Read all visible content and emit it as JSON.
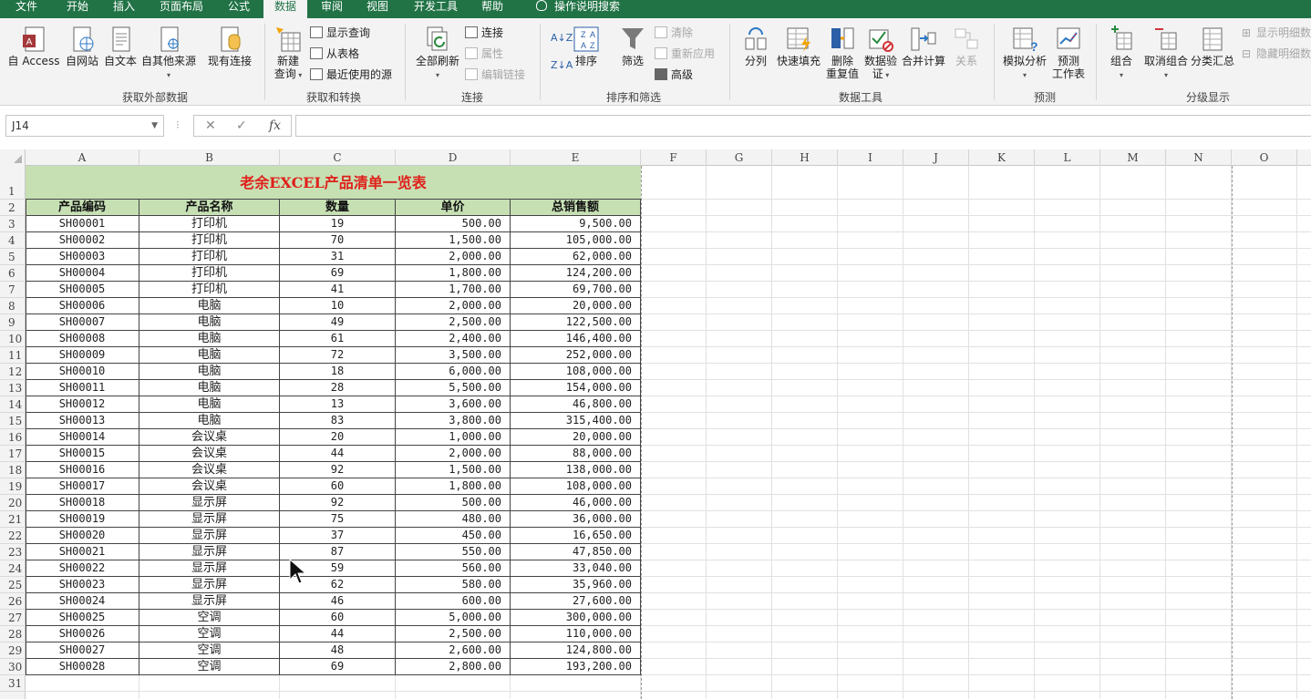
{
  "menu": {
    "tabs": [
      "文件",
      "开始",
      "插入",
      "页面布局",
      "公式",
      "数据",
      "审阅",
      "视图",
      "开发工具",
      "帮助"
    ],
    "active": "数据",
    "tell_me": "操作说明搜索"
  },
  "ribbon": {
    "get_external": {
      "group_label": "获取外部数据",
      "access": "自 Access",
      "web": "自网站",
      "text": "自文本",
      "other": "自其他来源",
      "existing": "现有连接"
    },
    "get_transform": {
      "group_label": "获取和转换",
      "new_query_1": "新建",
      "new_query_2": "查询",
      "show_queries": "显示查询",
      "from_table": "从表格",
      "recent_sources": "最近使用的源"
    },
    "connections": {
      "group_label": "连接",
      "refresh_all": "全部刷新",
      "connections": "连接",
      "properties": "属性",
      "edit_links": "编辑链接"
    },
    "sort_filter": {
      "group_label": "排序和筛选",
      "sort": "排序",
      "filter": "筛选",
      "clear": "清除",
      "reapply": "重新应用",
      "advanced": "高级"
    },
    "data_tools": {
      "group_label": "数据工具",
      "text_to_columns": "分列",
      "flash_fill": "快速填充",
      "remove_dup_1": "删除",
      "remove_dup_2": "重复值",
      "validation_1": "数据验",
      "validation_2": "证",
      "consolidate": "合并计算",
      "relationships": "关系"
    },
    "forecast": {
      "group_label": "预测",
      "what_if": "模拟分析",
      "forecast_1": "预测",
      "forecast_2": "工作表"
    },
    "outline": {
      "group_label": "分级显示",
      "group": "组合",
      "ungroup": "取消组合",
      "subtotal": "分类汇总",
      "show_detail": "显示明细数",
      "hide_detail": "隐藏明细数"
    }
  },
  "formula_bar": {
    "name_box": "J14",
    "cancel": "✕",
    "enter": "✓",
    "fx": "fx",
    "content": ""
  },
  "columns": [
    "A",
    "B",
    "C",
    "D",
    "E",
    "F",
    "G",
    "H",
    "I",
    "J",
    "K",
    "L",
    "M",
    "N",
    "O"
  ],
  "table": {
    "title": "老余EXCEL产品清单一览表",
    "headers": [
      "产品编码",
      "产品名称",
      "数量",
      "单价",
      "总销售额"
    ],
    "rows": [
      [
        "SH00001",
        "打印机",
        "19",
        "500.00",
        "9,500.00"
      ],
      [
        "SH00002",
        "打印机",
        "70",
        "1,500.00",
        "105,000.00"
      ],
      [
        "SH00003",
        "打印机",
        "31",
        "2,000.00",
        "62,000.00"
      ],
      [
        "SH00004",
        "打印机",
        "69",
        "1,800.00",
        "124,200.00"
      ],
      [
        "SH00005",
        "打印机",
        "41",
        "1,700.00",
        "69,700.00"
      ],
      [
        "SH00006",
        "电脑",
        "10",
        "2,000.00",
        "20,000.00"
      ],
      [
        "SH00007",
        "电脑",
        "49",
        "2,500.00",
        "122,500.00"
      ],
      [
        "SH00008",
        "电脑",
        "61",
        "2,400.00",
        "146,400.00"
      ],
      [
        "SH00009",
        "电脑",
        "72",
        "3,500.00",
        "252,000.00"
      ],
      [
        "SH00010",
        "电脑",
        "18",
        "6,000.00",
        "108,000.00"
      ],
      [
        "SH00011",
        "电脑",
        "28",
        "5,500.00",
        "154,000.00"
      ],
      [
        "SH00012",
        "电脑",
        "13",
        "3,600.00",
        "46,800.00"
      ],
      [
        "SH00013",
        "电脑",
        "83",
        "3,800.00",
        "315,400.00"
      ],
      [
        "SH00014",
        "会议桌",
        "20",
        "1,000.00",
        "20,000.00"
      ],
      [
        "SH00015",
        "会议桌",
        "44",
        "2,000.00",
        "88,000.00"
      ],
      [
        "SH00016",
        "会议桌",
        "92",
        "1,500.00",
        "138,000.00"
      ],
      [
        "SH00017",
        "会议桌",
        "60",
        "1,800.00",
        "108,000.00"
      ],
      [
        "SH00018",
        "显示屏",
        "92",
        "500.00",
        "46,000.00"
      ],
      [
        "SH00019",
        "显示屏",
        "75",
        "480.00",
        "36,000.00"
      ],
      [
        "SH00020",
        "显示屏",
        "37",
        "450.00",
        "16,650.00"
      ],
      [
        "SH00021",
        "显示屏",
        "87",
        "550.00",
        "47,850.00"
      ],
      [
        "SH00022",
        "显示屏",
        "59",
        "560.00",
        "33,040.00"
      ],
      [
        "SH00023",
        "显示屏",
        "62",
        "580.00",
        "35,960.00"
      ],
      [
        "SH00024",
        "显示屏",
        "46",
        "600.00",
        "27,600.00"
      ],
      [
        "SH00025",
        "空调",
        "60",
        "5,000.00",
        "300,000.00"
      ],
      [
        "SH00026",
        "空调",
        "44",
        "2,500.00",
        "110,000.00"
      ],
      [
        "SH00027",
        "空调",
        "48",
        "2,600.00",
        "124,800.00"
      ],
      [
        "SH00028",
        "空调",
        "69",
        "2,800.00",
        "193,200.00"
      ]
    ]
  },
  "row_numbers": [
    "1",
    "2",
    "3",
    "4",
    "5",
    "6",
    "7",
    "8",
    "9",
    "10",
    "11",
    "12",
    "13",
    "14",
    "15",
    "16",
    "17",
    "18",
    "19",
    "20",
    "21",
    "22",
    "23",
    "24",
    "25",
    "26",
    "27",
    "28",
    "29",
    "30",
    "31"
  ],
  "colors": {
    "excel_green": "#217346",
    "header_fill": "#c6e0b4",
    "title_red": "#e0201b"
  }
}
